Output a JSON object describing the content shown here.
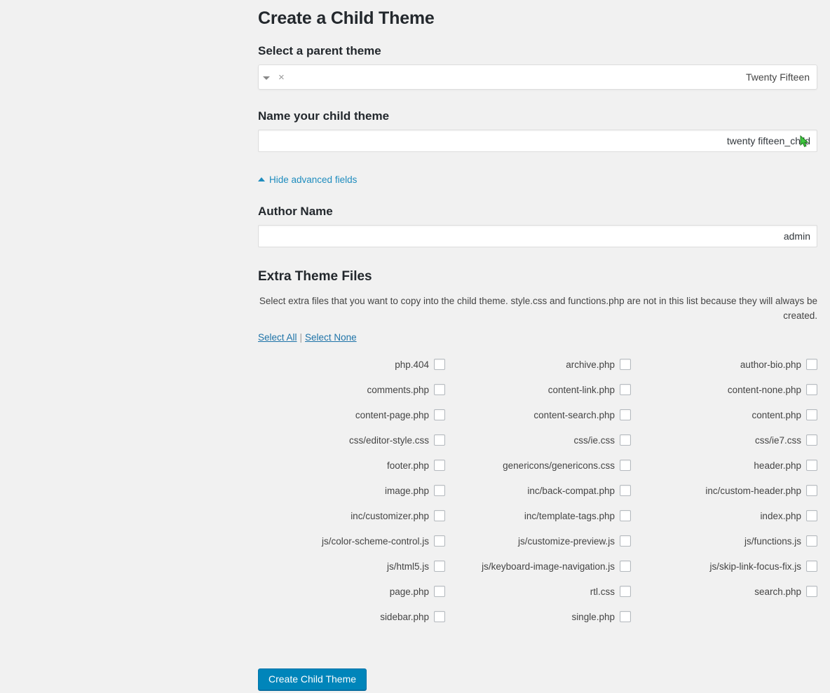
{
  "page": {
    "title": "Create a Child Theme",
    "background_color": "#f1f1f1"
  },
  "parent_theme": {
    "label": "Select a parent theme",
    "value": "Twenty Fifteen",
    "clear_icon": "×",
    "dropdown_icon": "chevron-down"
  },
  "child_theme_name": {
    "label": "Name your child theme",
    "value": "twenty fifteen_child",
    "placeholder": ""
  },
  "advanced_toggle": {
    "label": "Hide advanced fields",
    "icon": "triangle-up",
    "color": "#1e8cbe"
  },
  "author": {
    "label": "Author Name",
    "value": "admin",
    "placeholder": ""
  },
  "extra_files": {
    "label": "Extra Theme Files",
    "help_text": "Select extra files that you want to copy into the child theme. style.css and functions.php are not in this list because they will always be created.",
    "help_line_1": "Select extra files that you want to copy into the child theme. style.css and functions.php are not in this list because they will always be",
    "help_line_2": ".created",
    "select_all_label": "Select All",
    "select_none_label": "Select None",
    "separator": "|",
    "columns": [
      {
        "items": [
          {
            "name": "author-bio.php",
            "checked": false
          },
          {
            "name": "content-none.php",
            "checked": false
          },
          {
            "name": "content.php",
            "checked": false
          },
          {
            "name": "css/ie7.css",
            "checked": false
          },
          {
            "name": "header.php",
            "checked": false
          },
          {
            "name": "inc/custom-header.php",
            "checked": false
          },
          {
            "name": "index.php",
            "checked": false
          },
          {
            "name": "js/functions.js",
            "checked": false
          },
          {
            "name": "js/skip-link-focus-fix.js",
            "checked": false
          },
          {
            "name": "search.php",
            "checked": false
          }
        ]
      },
      {
        "items": [
          {
            "name": "archive.php",
            "checked": false
          },
          {
            "name": "content-link.php",
            "checked": false
          },
          {
            "name": "content-search.php",
            "checked": false
          },
          {
            "name": "css/ie.css",
            "checked": false
          },
          {
            "name": "genericons/genericons.css",
            "checked": false
          },
          {
            "name": "inc/back-compat.php",
            "checked": false
          },
          {
            "name": "inc/template-tags.php",
            "checked": false
          },
          {
            "name": "js/customize-preview.js",
            "checked": false
          },
          {
            "name": "js/keyboard-image-navigation.js",
            "checked": false
          },
          {
            "name": "rtl.css",
            "checked": false
          },
          {
            "name": "single.php",
            "checked": false
          }
        ]
      },
      {
        "items": [
          {
            "name": "php.404",
            "checked": false
          },
          {
            "name": "comments.php",
            "checked": false
          },
          {
            "name": "content-page.php",
            "checked": false
          },
          {
            "name": "css/editor-style.css",
            "checked": false
          },
          {
            "name": "footer.php",
            "checked": false
          },
          {
            "name": "image.php",
            "checked": false
          },
          {
            "name": "inc/customizer.php",
            "checked": false
          },
          {
            "name": "js/color-scheme-control.js",
            "checked": false
          },
          {
            "name": "js/html5.js",
            "checked": false
          },
          {
            "name": "page.php",
            "checked": false
          },
          {
            "name": "sidebar.php",
            "checked": false
          }
        ]
      }
    ]
  },
  "submit": {
    "label": "Create Child Theme",
    "color": "#0085ba"
  }
}
